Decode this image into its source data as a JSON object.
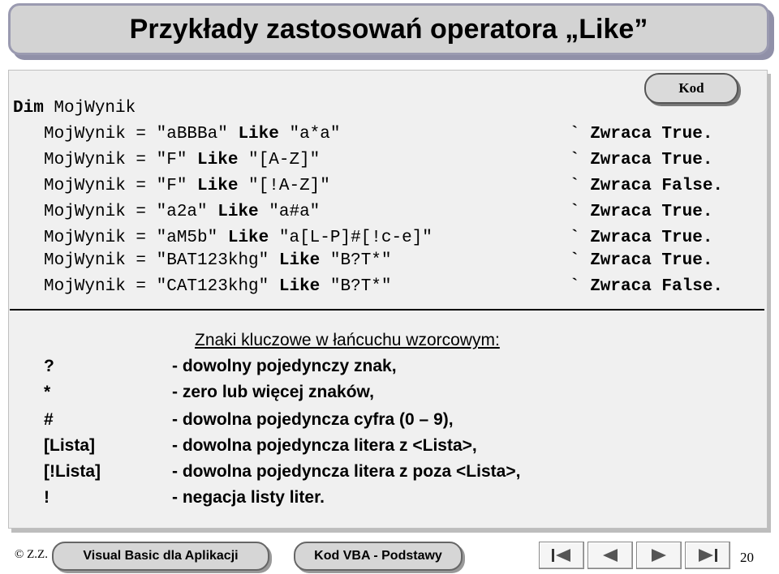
{
  "slide": {
    "title": "Przykłady zastosowań operatora „Like”",
    "badge": "Kod",
    "page_number": "20"
  },
  "code": {
    "declaration": {
      "kw": "Dim",
      "rest": " MojWynik"
    },
    "lines": [
      {
        "lhs": "MojWynik = \"aBBBa\" ",
        "kw": "Like",
        "rhs": " \"a*a\"",
        "result": "` Zwraca True."
      },
      {
        "lhs": "MojWynik = \"F\" ",
        "kw": "Like",
        "rhs": " \"[A-Z]\"",
        "result": "` Zwraca True."
      },
      {
        "lhs": "MojWynik = \"F\" ",
        "kw": "Like",
        "rhs": " \"[!A-Z]\"",
        "result": "` Zwraca False."
      },
      {
        "lhs": "MojWynik = \"a2a\" ",
        "kw": "Like",
        "rhs": " \"a#a\"",
        "result": "` Zwraca True."
      },
      {
        "lhs": "MojWynik = \"aM5b\" ",
        "kw": "Like",
        "rhs": " \"a[L-P]#[!c-e]\"",
        "result": "` Zwraca True."
      },
      {
        "lhs": "MojWynik = \"BAT123khg\" ",
        "kw": "Like",
        "rhs": " \"B?T*\"",
        "result": "` Zwraca True."
      },
      {
        "lhs": "MojWynik = \"CAT123khg\" ",
        "kw": "Like",
        "rhs": " \"B?T*\"",
        "result": "` Zwraca False."
      }
    ]
  },
  "keys": {
    "title": "Znaki kluczowe w łańcuchu wzorcowym:",
    "items": [
      {
        "sym": "?",
        "desc": "- dowolny pojedynczy znak,"
      },
      {
        "sym": "*",
        "desc": "- zero lub więcej znaków,"
      },
      {
        "sym": "#",
        "desc": "- dowolna pojedyncza cyfra (0 – 9),"
      },
      {
        "sym": "[Lista]",
        "desc": "- dowolna pojedyncza litera z <Lista>,"
      },
      {
        "sym": "[!Lista]",
        "desc": "- dowolna pojedyncza litera z poza <Lista>,"
      },
      {
        "sym": "!",
        "desc": "- negacja listy liter."
      }
    ]
  },
  "footer": {
    "copyright": "© Z.Z.",
    "button1": "Visual Basic dla Aplikacji",
    "button2": "Kod VBA - Podstawy"
  },
  "nav_icons": [
    "first-icon",
    "prev-icon",
    "next-icon",
    "last-icon"
  ]
}
